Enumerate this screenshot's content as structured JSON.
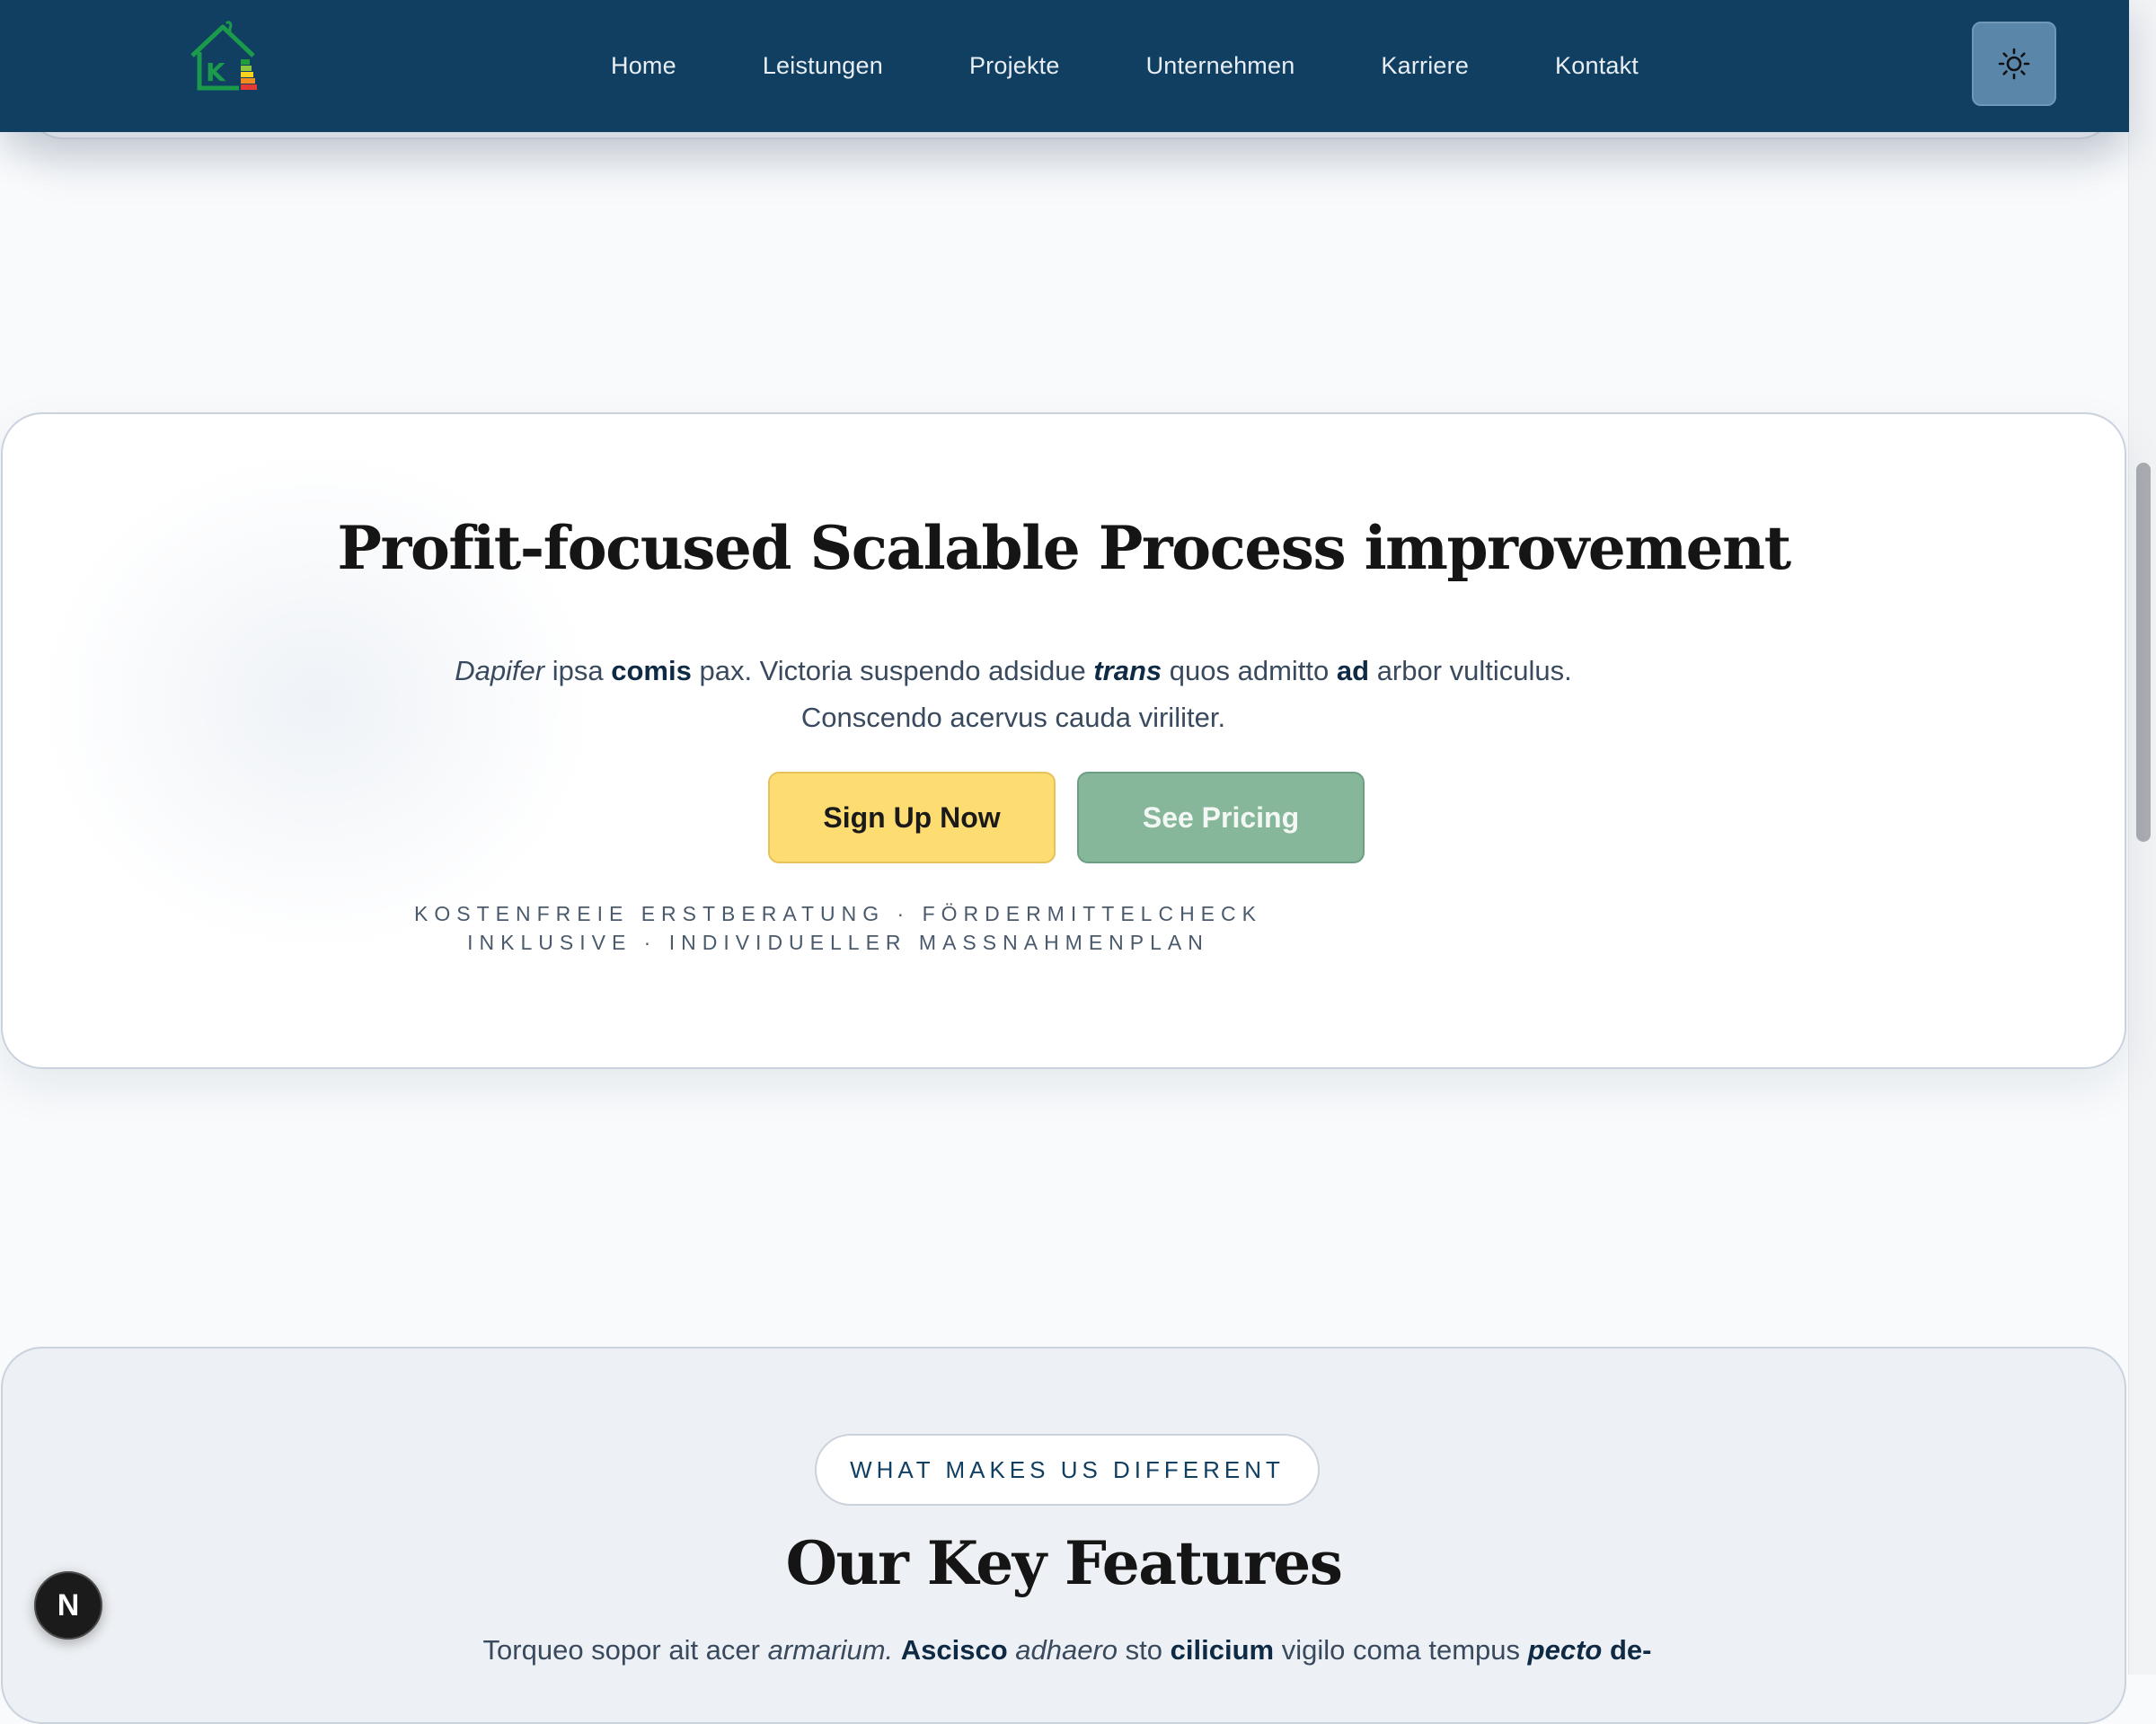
{
  "nav": {
    "links": [
      "Home",
      "Leistungen",
      "Projekte",
      "Unternehmen",
      "Karriere",
      "Kontakt"
    ],
    "logo_letter": "K"
  },
  "cta": {
    "title": "Profit-focused Scalable Process improvement",
    "body": {
      "w1": "Dapifer",
      "t1": " ipsa ",
      "w2": "comis",
      "t2": " pax. Victoria suspendo adsidue ",
      "w3": "trans",
      "t3": " quos admitto ",
      "w4": "ad",
      "t4": " arbor vulticulus.",
      "line2": "Conscendo acervus cauda viriliter."
    },
    "primary_label": "Sign Up Now",
    "secondary_label": "See Pricing",
    "note_line1": "KOSTENFREIE ERSTBERATUNG · FÖRDERMITTELCHECK",
    "note_line2": "INKLUSIVE · INDIVIDUELLER MASSNAHMENPLAN"
  },
  "features": {
    "eyebrow": "WHAT MAKES US DIFFERENT",
    "title": "Our Key Features",
    "body": {
      "t1": "Torqueo sopor ait acer ",
      "w1": "armarium.",
      "t2": " ",
      "w2": "Ascisco",
      "t3": " ",
      "w3": "adhaero",
      "t4": " sto ",
      "w4": "cilicium",
      "t5": " vigilo coma tempus ",
      "w5": "pecto",
      "t6": " ",
      "w6": "de-"
    }
  },
  "badge_letter": "N",
  "colors": {
    "nav_bg": "#103f62",
    "primary": "#fddc72",
    "secondary": "#86b79a"
  }
}
